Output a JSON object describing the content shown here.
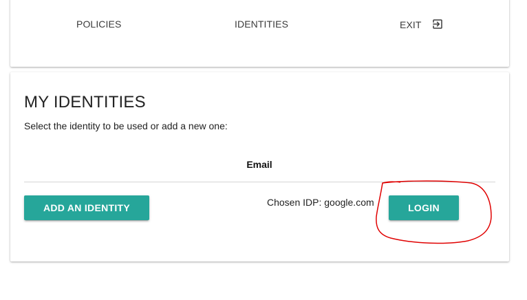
{
  "nav": {
    "policies_label": "POLICIES",
    "identities_label": "IDENTITIES",
    "exit_label": "EXIT",
    "exit_icon": "exit-to-app-icon"
  },
  "main": {
    "title": "MY IDENTITIES",
    "subtitle": "Select the identity to be used or add a new one:",
    "table": {
      "columns": [
        "Email"
      ],
      "rows": []
    },
    "add_identity_label": "ADD AN IDENTITY",
    "chosen_idp_text": "Chosen IDP: google.com",
    "login_label": "LOGIN"
  },
  "colors": {
    "accent": "#26a69a",
    "annotation": "#e00000"
  }
}
